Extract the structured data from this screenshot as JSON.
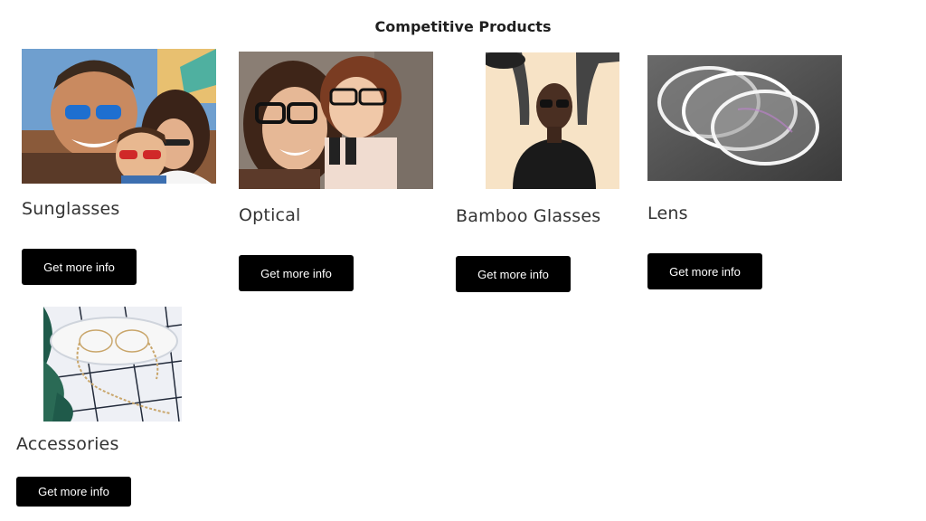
{
  "page": {
    "title": "Competitive Products"
  },
  "products": [
    {
      "name": "Sunglasses",
      "button_label": "Get more info"
    },
    {
      "name": "Optical",
      "button_label": "Get more info"
    },
    {
      "name": "Bamboo Glasses",
      "button_label": "Get more info"
    },
    {
      "name": "Lens",
      "button_label": "Get more info"
    },
    {
      "name": "Accessories",
      "button_label": "Get more info"
    }
  ],
  "colors": {
    "button_bg": "#000000",
    "button_text": "#ffffff",
    "heading_text": "#333333"
  }
}
